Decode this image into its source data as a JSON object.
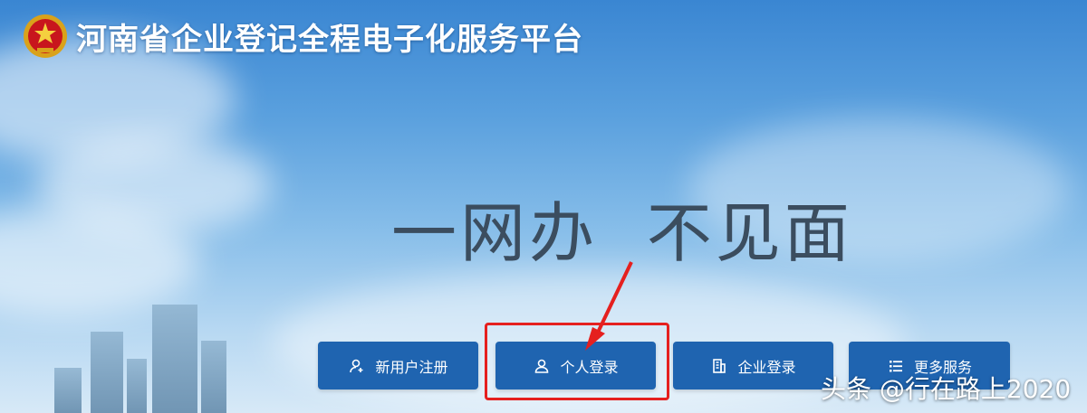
{
  "header": {
    "title": "河南省企业登记全程电子化服务平台",
    "emblem_icon": "national-emblem-icon"
  },
  "hero": {
    "slogan": "一网办  不见面"
  },
  "actions": [
    {
      "label": "新用户注册",
      "icon": "user-add-icon"
    },
    {
      "label": "个人登录",
      "icon": "user-icon"
    },
    {
      "label": "企业登录",
      "icon": "building-icon"
    },
    {
      "label": "更多服务",
      "icon": "list-icon"
    }
  ],
  "annotation": {
    "highlight_color": "#e5201f"
  },
  "watermark": {
    "text": "头条 @行在路上2020"
  },
  "colors": {
    "button_bg": "#1f64b0",
    "slogan_text": "#3b4d5f"
  }
}
